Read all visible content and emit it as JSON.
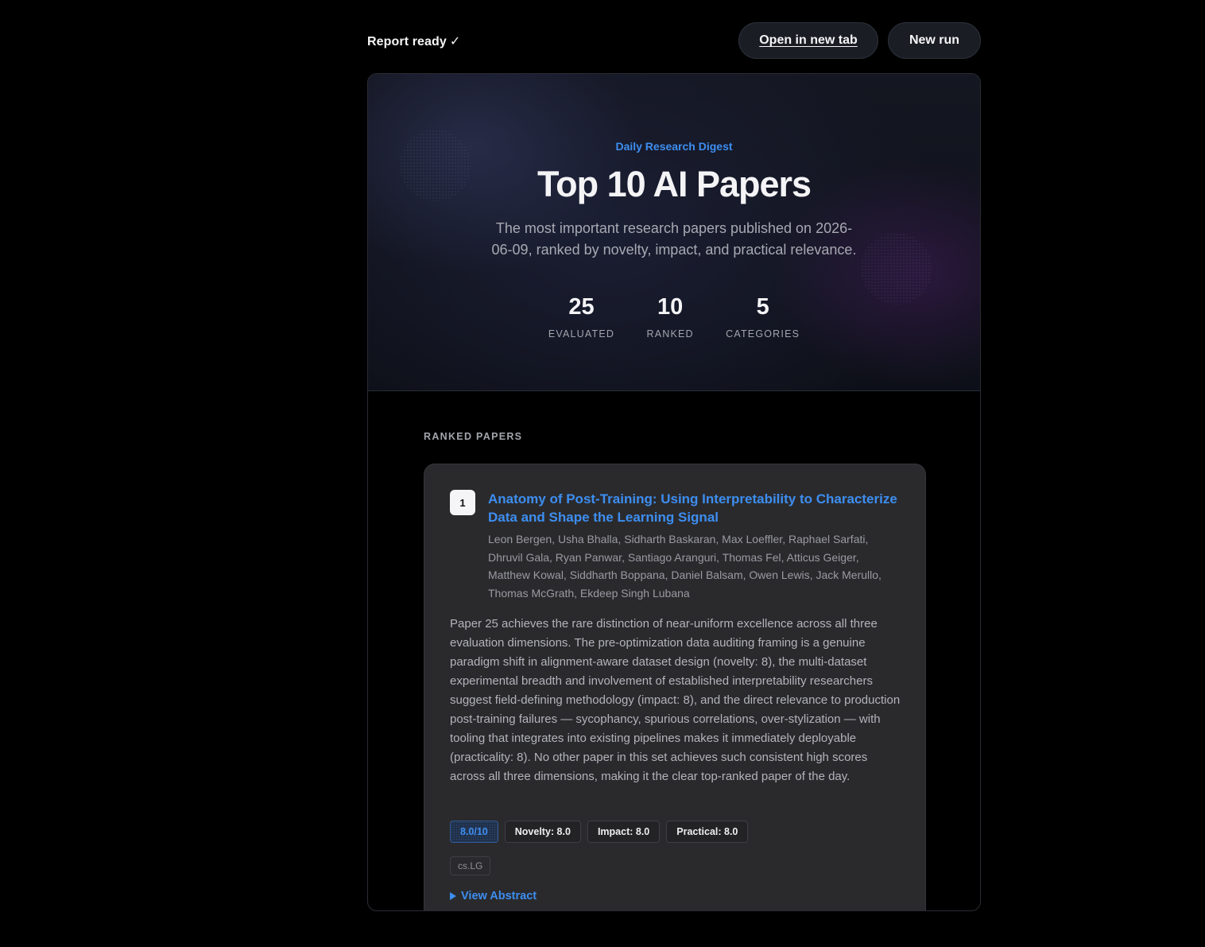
{
  "topbar": {
    "status": "Report ready",
    "status_mark": "✓",
    "open_tab_label": "Open in new tab",
    "new_run_label": "New run"
  },
  "hero": {
    "eyebrow": "Daily Research Digest",
    "title": "Top 10 AI Papers",
    "subtitle": "The most important research papers published on 2026-06-09, ranked by novelty, impact, and practical relevance.",
    "stats": [
      {
        "value": "25",
        "label": "EVALUATED"
      },
      {
        "value": "10",
        "label": "RANKED"
      },
      {
        "value": "5",
        "label": "CATEGORIES"
      }
    ]
  },
  "section": {
    "label": "RANKED PAPERS"
  },
  "papers": [
    {
      "rank": "1",
      "title": "Anatomy of Post-Training: Using Interpretability to Characterize Data and Shape the Learning Signal",
      "authors": "Leon Bergen, Usha Bhalla, Sidharth Baskaran, Max Loeffler, Raphael Sarfati, Dhruvil Gala, Ryan Panwar, Santiago Aranguri, Thomas Fel, Atticus Geiger, Matthew Kowal, Siddharth Boppana, Daniel Balsam, Owen Lewis, Jack Merullo, Thomas McGrath, Ekdeep Singh Lubana",
      "summary": "Paper 25 achieves the rare distinction of near-uniform excellence across all three evaluation dimensions. The pre-optimization data auditing framing is a genuine paradigm shift in alignment-aware dataset design (novelty: 8), the multi-dataset experimental breadth and involvement of established interpretability researchers suggest field-defining methodology (impact: 8), and the direct relevance to production post-training failures — sycophancy, spurious correlations, over-stylization — with tooling that integrates into existing pipelines makes it immediately deployable (practicality: 8). No other paper in this set achieves such consistent high scores across all three dimensions, making it the clear top-ranked paper of the day.",
      "score": "8.0/10",
      "novelty": "Novelty: 8.0",
      "impact": "Impact: 8.0",
      "practical": "Practical: 8.0",
      "category": "cs.LG",
      "abstract_toggle": "View Abstract"
    }
  ],
  "colors": {
    "accent": "#3d8ef0",
    "background": "#000000",
    "card": "#2a2a2d"
  }
}
